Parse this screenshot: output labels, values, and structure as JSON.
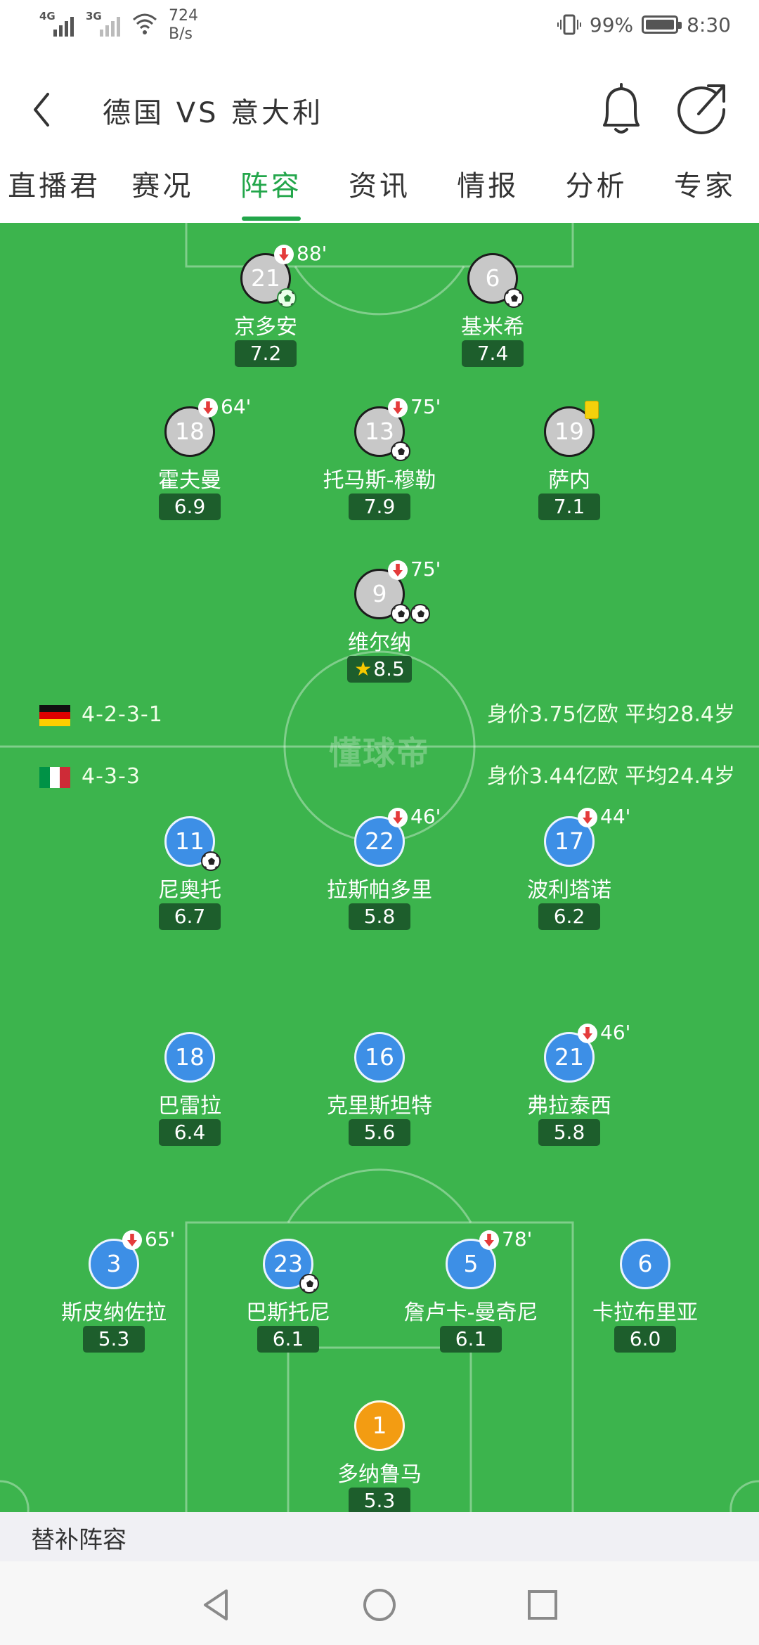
{
  "status_bar": {
    "signal1": "4G",
    "signal2": "3G",
    "net_speed_value": "724",
    "net_speed_unit": "B/s",
    "battery": "99%",
    "battery_level": 0.99,
    "time": "8:30"
  },
  "header": {
    "title": "德国 VS 意大利"
  },
  "tabs": [
    {
      "label": "直播君"
    },
    {
      "label": "赛况"
    },
    {
      "label": "阵容",
      "active": true
    },
    {
      "label": "资讯"
    },
    {
      "label": "情报"
    },
    {
      "label": "分析"
    },
    {
      "label": "专家"
    }
  ],
  "pitch": {
    "watermark": "懂球帝",
    "colors": {
      "pitch": "#3cb44d",
      "active_tab": "#22a64a"
    },
    "germany": {
      "formation": "4-2-3-1",
      "stats": "身价3.75亿欧 平均28.4岁",
      "players": [
        {
          "number": "21",
          "name": "京多安",
          "rating": "7.2",
          "sub_minute": "88'",
          "goal_icon": "green"
        },
        {
          "number": "6",
          "name": "基米希",
          "rating": "7.4",
          "goal_icon": "black"
        },
        {
          "number": "18",
          "name": "霍夫曼",
          "rating": "6.9",
          "sub_minute": "64'"
        },
        {
          "number": "13",
          "name": "托马斯-穆勒",
          "rating": "7.9",
          "sub_minute": "75'",
          "goal_icon": "black"
        },
        {
          "number": "19",
          "name": "萨内",
          "rating": "7.1",
          "yellow_card": true
        },
        {
          "number": "9",
          "name": "维尔纳",
          "rating": "8.5",
          "sub_minute": "75'",
          "goals": 2,
          "star": true
        }
      ]
    },
    "italy": {
      "formation": "4-3-3",
      "stats": "身价3.44亿欧 平均24.4岁",
      "players": [
        {
          "number": "11",
          "name": "尼奥托",
          "rating": "6.7",
          "goal_icon": "black"
        },
        {
          "number": "22",
          "name": "拉斯帕多里",
          "rating": "5.8",
          "sub_minute": "46'"
        },
        {
          "number": "17",
          "name": "波利塔诺",
          "rating": "6.2",
          "sub_minute": "44'"
        },
        {
          "number": "18",
          "name": "巴雷拉",
          "rating": "6.4"
        },
        {
          "number": "16",
          "name": "克里斯坦特",
          "rating": "5.6"
        },
        {
          "number": "21",
          "name": "弗拉泰西",
          "rating": "5.8",
          "sub_minute": "46'"
        },
        {
          "number": "3",
          "name": "斯皮纳佐拉",
          "rating": "5.3",
          "sub_minute": "65'"
        },
        {
          "number": "23",
          "name": "巴斯托尼",
          "rating": "6.1",
          "goal_icon": "black"
        },
        {
          "number": "5",
          "name": "詹卢卡-曼奇尼",
          "rating": "6.1",
          "sub_minute": "78'"
        },
        {
          "number": "6",
          "name": "卡拉布里亚",
          "rating": "6.0"
        },
        {
          "number": "1",
          "name": "多纳鲁马",
          "rating": "5.3"
        }
      ]
    }
  },
  "substitutes": {
    "header": "替补阵容"
  },
  "navigation": {
    "back": "back-triangle-icon",
    "home": "home-circle-icon",
    "recents": "recents-square-icon"
  }
}
